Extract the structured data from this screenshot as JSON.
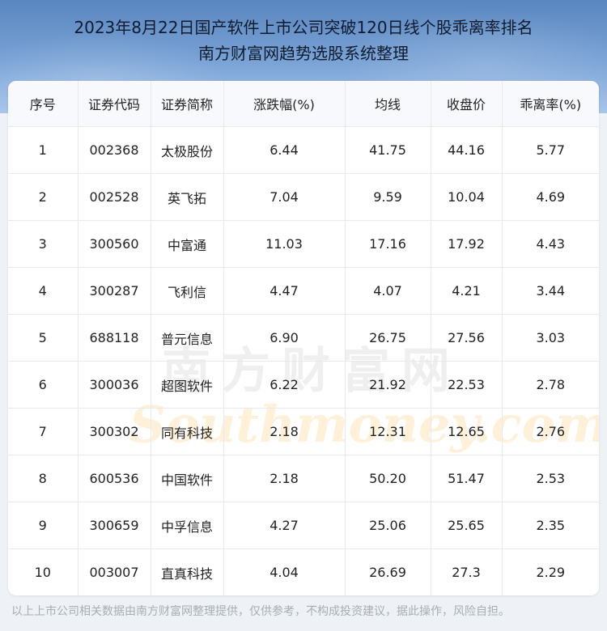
{
  "header": {
    "title_line1": "2023年8月22日国产软件上市公司突破120日线个股乖离率排名",
    "title_line2": "南方财富网趋势选股系统整理"
  },
  "table": {
    "columns": [
      "序号",
      "证券代码",
      "证券简称",
      "涨跌幅(%)",
      "均线",
      "收盘价",
      "乖离率(%)"
    ],
    "rows": [
      [
        "1",
        "002368",
        "太极股份",
        "6.44",
        "41.75",
        "44.16",
        "5.77"
      ],
      [
        "2",
        "002528",
        "英飞拓",
        "7.04",
        "9.59",
        "10.04",
        "4.69"
      ],
      [
        "3",
        "300560",
        "中富通",
        "11.03",
        "17.16",
        "17.92",
        "4.43"
      ],
      [
        "4",
        "300287",
        "飞利信",
        "4.47",
        "4.07",
        "4.21",
        "3.44"
      ],
      [
        "5",
        "688118",
        "普元信息",
        "6.90",
        "26.75",
        "27.56",
        "3.03"
      ],
      [
        "6",
        "300036",
        "超图软件",
        "6.22",
        "21.92",
        "22.53",
        "2.78"
      ],
      [
        "7",
        "300302",
        "同有科技",
        "2.18",
        "12.31",
        "12.65",
        "2.76"
      ],
      [
        "8",
        "600536",
        "中国软件",
        "2.18",
        "50.20",
        "51.47",
        "2.53"
      ],
      [
        "9",
        "300659",
        "中孚信息",
        "4.27",
        "25.06",
        "25.65",
        "2.35"
      ],
      [
        "10",
        "003007",
        "直真科技",
        "4.04",
        "26.69",
        "27.3",
        "2.29"
      ]
    ]
  },
  "watermark": {
    "chinese": "南方财富网",
    "english": "Southmoney.com"
  },
  "footer": {
    "disclaimer": "以上上市公司相关数据由南方财富网整理提供，仅供参考，不构成投资建议，据此操作，风险自担。"
  },
  "colors": {
    "header_top": "#5a86bf",
    "header_bottom": "#a9c5ea",
    "grid_line": "#e6e9ee",
    "footer_text": "#a7adb6"
  }
}
